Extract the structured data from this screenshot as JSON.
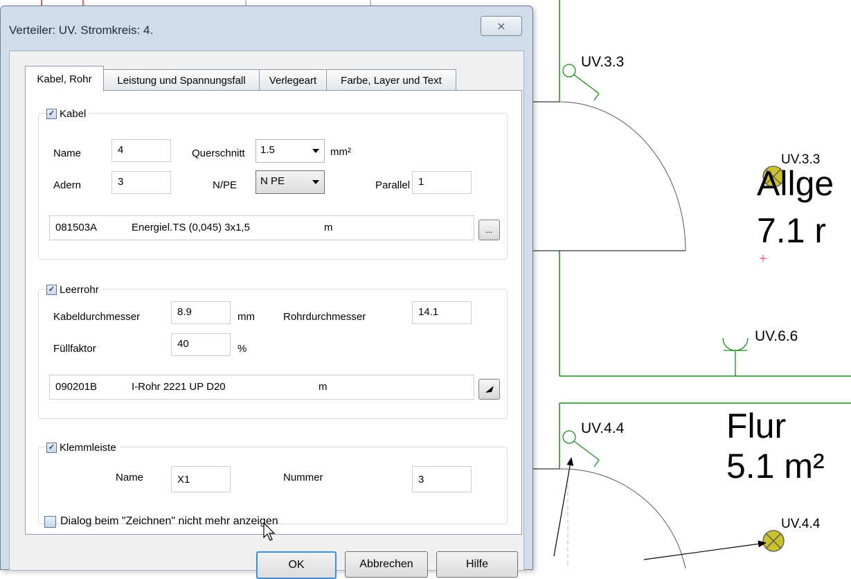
{
  "cad": {
    "labels": [
      "UV.3.3",
      "UV.3.3",
      "UV.6.6",
      "UV.4.4",
      "UV.4.4"
    ],
    "room1_name": "Allge",
    "room1_area": "7.1 r",
    "room2_name": "Flur",
    "room2_area": "5.1 m²"
  },
  "dialog": {
    "title": "Verteiler: UV. Stromkreis: 4.",
    "close_label": "⨯",
    "tabs": [
      "Kabel, Rohr",
      "Leistung und Spannungsfall",
      "Verlegeart",
      "Farbe, Layer und Text"
    ],
    "kabel": {
      "group_label": "Kabel",
      "checked": true,
      "name_label": "Name",
      "name_value": "4",
      "querschnitt_label": "Querschnitt",
      "querschnitt_value": "1.5",
      "unit_mm2": "mm²",
      "adern_label": "Adern",
      "adern_value": "3",
      "npe_label": "N/PE",
      "npe_value": "N PE",
      "parallel_label": "Parallel",
      "parallel_value": "1",
      "article_code": "081503A",
      "article_desc": "Energiel.TS (0,045) 3x1,5",
      "article_unit": "m",
      "browse_label": "..."
    },
    "leerrohr": {
      "group_label": "Leerrohr",
      "checked": true,
      "kabeldurchmesser_label": "Kabeldurchmesser",
      "kabeldurchmesser_value": "8.9",
      "unit_mm": "mm",
      "rohrdurchmesser_label": "Rohrdurchmesser",
      "rohrdurchmesser_value": "14.1",
      "fuellfaktor_label": "Füllfaktor",
      "fuellfaktor_value": "40",
      "unit_percent": "%",
      "article_code": "090201B",
      "article_desc": "I-Rohr 2221 UP D20",
      "article_unit": "m"
    },
    "klemmleiste": {
      "group_label": "Klemmleiste",
      "checked": true,
      "name_label": "Name",
      "name_value": "X1",
      "nummer_label": "Nummer",
      "nummer_value": "3"
    },
    "dont_show_label": "Dialog beim \"Zeichnen\" nicht mehr anzeigen",
    "dont_show_checked": false,
    "buttons": {
      "ok": "OK",
      "cancel": "Abbrechen",
      "help": "Hilfe"
    }
  },
  "colors": {
    "wall": "#1a8c1a",
    "lamp": "#c9c12e",
    "dialog_frame": "#cfdcea"
  }
}
